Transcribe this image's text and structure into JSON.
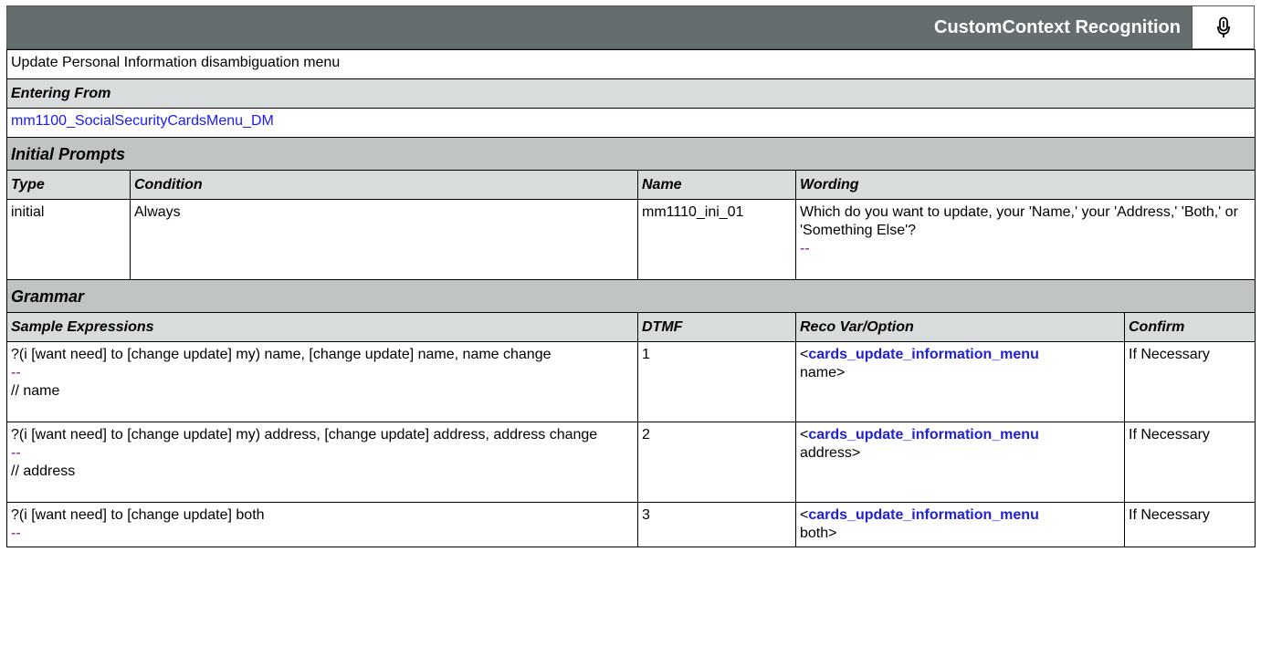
{
  "header": {
    "title": "CustomContext Recognition",
    "mic_icon": "microphone-icon"
  },
  "description": "Update Personal Information disambiguation menu",
  "entering_from": {
    "heading": "Entering From",
    "link": "mm1100_SocialSecurityCardsMenu_DM"
  },
  "initial_prompts": {
    "heading": "Initial Prompts",
    "columns": [
      "Type",
      "Condition",
      "Name",
      "Wording"
    ],
    "rows": [
      {
        "type": "initial",
        "condition": "Always",
        "name": "mm1110_ini_01",
        "wording": "Which do you want to update, your 'Name,' your 'Address,' 'Both,' or  'Something Else'?",
        "dash": "--"
      }
    ]
  },
  "grammar": {
    "heading": "Grammar",
    "columns": [
      "Sample Expressions",
      "DTMF",
      "Reco Var/Option",
      "Confirm"
    ],
    "rows": [
      {
        "expression": "?(i [want need] to [change update] my) name, [change update] name, name change",
        "dash": "--",
        "comment": "// name",
        "dtmf": "1",
        "reco_open": "<",
        "reco_var": "cards_update_information_menu",
        "reco_value": "name>",
        "confirm": "If Necessary"
      },
      {
        "expression": "?(i [want need] to [change update] my) address, [change update] address, address change",
        "dash": "--",
        "comment": "// address",
        "dtmf": "2",
        "reco_open": "<",
        "reco_var": "cards_update_information_menu",
        "reco_value": "address>",
        "confirm": "If Necessary"
      },
      {
        "expression": "?(i [want need] to [change update] both",
        "dash": "--",
        "comment": "",
        "dtmf": "3",
        "reco_open": "<",
        "reco_var": "cards_update_information_menu",
        "reco_value": "both>",
        "confirm": "If Necessary"
      }
    ]
  }
}
